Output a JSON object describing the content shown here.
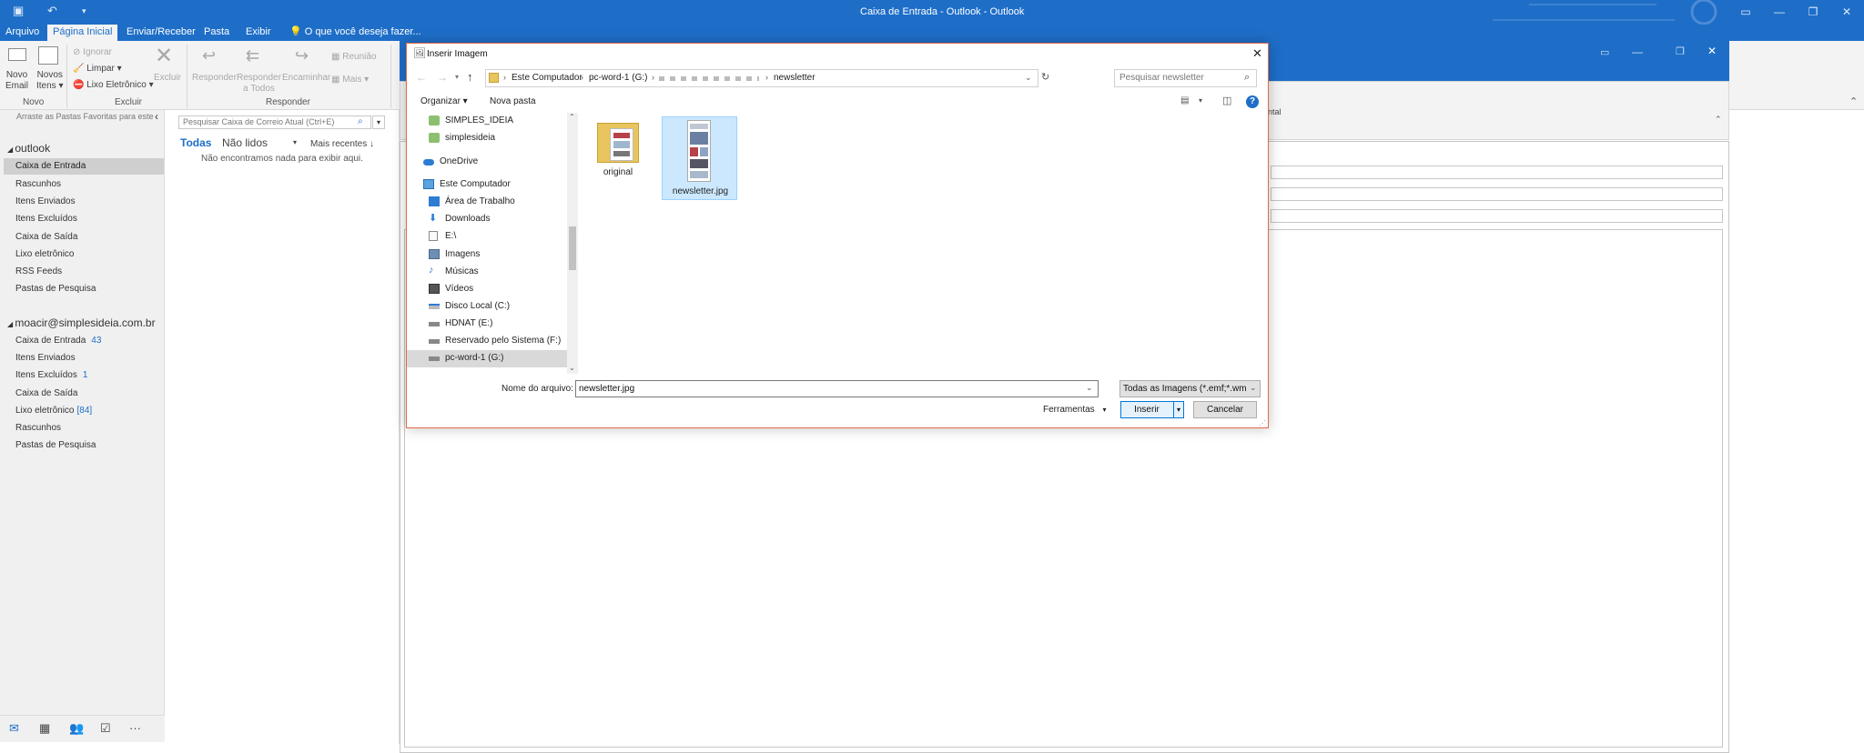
{
  "window": {
    "title": "Caixa de Entrada - Outlook - Outlook"
  },
  "menu": {
    "tabs": [
      "Arquivo",
      "Página Inicial",
      "Enviar/Receber",
      "Pasta",
      "Exibir"
    ],
    "tell_me": "O que você deseja fazer..."
  },
  "ribbon": {
    "new_email": [
      "Novo",
      "Email"
    ],
    "new_items": [
      "Novos",
      "Itens"
    ],
    "ignore": "Ignorar",
    "clean": "Limpar",
    "junk": "Lixo Eletrônico",
    "delete": "Excluir",
    "reply": "Responder",
    "reply_all": [
      "Responder",
      "a Todos"
    ],
    "forward": "Encaminhar",
    "meeting": "Reunião",
    "more": "Mais",
    "groups": {
      "new": "Novo",
      "delete": "Excluir",
      "respond": "Responder"
    },
    "partial_right": "ntal"
  },
  "nav": {
    "favorites_hint": "Arraste as Pastas Favoritas para este",
    "account1": {
      "name": "outlook",
      "folders": [
        "Caixa de Entrada",
        "Rascunhos",
        "Itens Enviados",
        "Itens Excluídos",
        "Caixa de Saída",
        "Lixo eletrônico",
        "RSS Feeds",
        "Pastas de Pesquisa"
      ]
    },
    "account2": {
      "name": "moacir@simplesideia.com.br",
      "folders": [
        {
          "name": "Caixa de Entrada",
          "badge": "43"
        },
        {
          "name": "Itens Enviados",
          "badge": ""
        },
        {
          "name": "Itens Excluídos",
          "badge": "1"
        },
        {
          "name": "Caixa de Saída",
          "badge": ""
        },
        {
          "name": "Lixo eletrônico",
          "badge": "[84]"
        },
        {
          "name": "Rascunhos",
          "badge": ""
        },
        {
          "name": "Pastas de Pesquisa",
          "badge": ""
        }
      ]
    }
  },
  "msglist": {
    "search_placeholder": "Pesquisar Caixa de Correio Atual (Ctrl+E)",
    "filter_all": "Todas",
    "filter_unread": "Não lidos",
    "sort": "Mais recentes",
    "empty": "Não encontramos nada para exibir aqui."
  },
  "dialog": {
    "title": "Inserir Imagem",
    "breadcrumb": [
      "Este Computador",
      "pc-word-1 (G:)",
      "newsletter"
    ],
    "search_placeholder": "Pesquisar newsletter",
    "organize": "Organizar",
    "new_folder": "Nova pasta",
    "help": "?",
    "tree": [
      {
        "label": "SIMPLES_IDEIA",
        "icon": "user-folder-icon"
      },
      {
        "label": "simplesideia",
        "icon": "user-folder-icon"
      },
      {
        "label": "OneDrive",
        "icon": "onedrive-cloud-icon"
      },
      {
        "label": "Este Computador",
        "icon": "computer-icon"
      },
      {
        "label": "Área de Trabalho",
        "icon": "desktop-icon"
      },
      {
        "label": "Downloads",
        "icon": "download-arrow-icon"
      },
      {
        "label": "E:\\",
        "icon": "document-icon"
      },
      {
        "label": "Imagens",
        "icon": "pictures-icon"
      },
      {
        "label": "Músicas",
        "icon": "music-note-icon"
      },
      {
        "label": "Vídeos",
        "icon": "video-icon"
      },
      {
        "label": "Disco Local (C:)",
        "icon": "drive-icon"
      },
      {
        "label": "HDNAT (E:)",
        "icon": "drive-icon"
      },
      {
        "label": "Reservado pelo Sistema (F:)",
        "icon": "drive-icon"
      },
      {
        "label": "pc-word-1 (G:)",
        "icon": "drive-icon"
      }
    ],
    "files": [
      {
        "name": "original",
        "type": "folder"
      },
      {
        "name": "newsletter.jpg",
        "type": "image"
      }
    ],
    "filename_label": "Nome do arquivo:",
    "filename_value": "newsletter.jpg",
    "filter_value": "Todas as Imagens (*.emf;*.wmf",
    "tools": "Ferramentas",
    "insert": "Inserir",
    "cancel": "Cancelar"
  },
  "colors": {
    "accent": "#1e6ec8",
    "dialog_border": "#e26b46",
    "selection": "#cce8ff"
  }
}
